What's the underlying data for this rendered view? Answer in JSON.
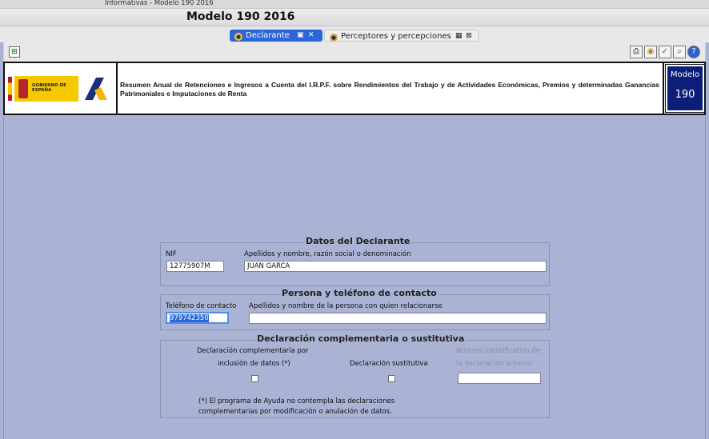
{
  "window": {
    "os_title": "Informativas - Modelo 190 2016",
    "app_title": "Modelo 190 2016"
  },
  "tabs": [
    {
      "label": "Declarante"
    },
    {
      "label": "Perceptores y percepciones"
    }
  ],
  "header": {
    "logo_text": "GOBIERNO DE ESPAÑA",
    "description": "Resumen Anual de Retenciones e Ingresos a Cuenta del I.R.P.F. sobre Rendimientos del Trabajo y de Actividades Económicas, Premios y determinadas Ganancias Patrimoniales e Imputaciones de Renta",
    "model_label": "Modelo",
    "model_number": "190"
  },
  "declarante": {
    "title": "Datos del Declarante",
    "nif_label": "NIF",
    "nif_value": "12775907M",
    "name_label": "Apellidos y nombre, razón social o denominación",
    "name_value": "JUAN GARCA"
  },
  "contacto": {
    "title": "Persona y teléfono de contacto",
    "phone_label": "Teléfono de contacto",
    "phone_value": "979742350",
    "person_label": "Apellidos y nombre de la persona con quien relacionarse",
    "person_value": ""
  },
  "complementaria": {
    "title": "Declaración complementaria o sustitutiva",
    "comp_label_line1": "Declaración complementaria por",
    "comp_label_line2": "inclusión de datos (*)",
    "sust_label": "Declaración sustitutiva",
    "num_label_line1": "Número identificativo de",
    "num_label_line2": "la declaración anterior",
    "num_value": "",
    "footnote_line1": "(*) El programa de Ayuda no contempla las declaraciones",
    "footnote_line2": "complementarias por modificación o anulación de datos."
  },
  "colors": {
    "background": "#aab3d4",
    "tab_active": "#2d66d8",
    "model_box": "#0d1e78"
  }
}
